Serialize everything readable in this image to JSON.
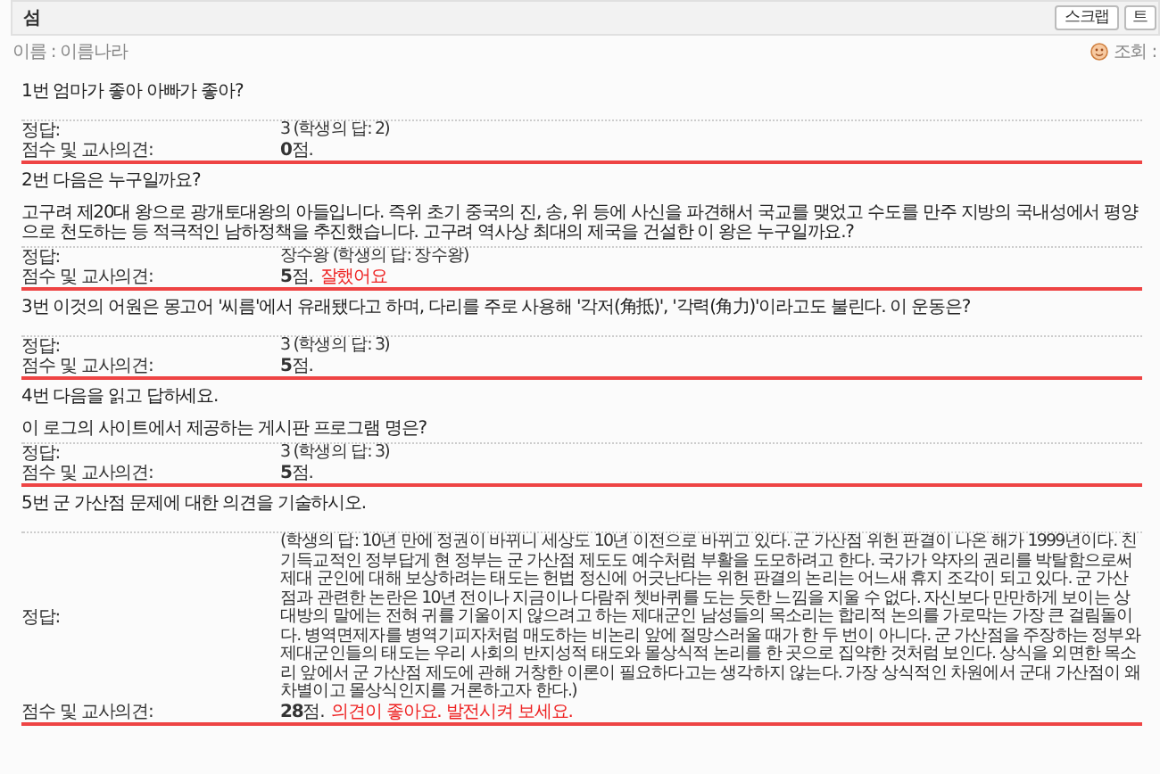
{
  "header": {
    "title": "섬",
    "buttons": [
      "스크랩",
      "트"
    ]
  },
  "meta": {
    "name": "이름 : 이름나라",
    "views": "조회 :"
  },
  "questions": [
    {
      "title": "1번 엄마가 좋아 아빠가 좋아?",
      "answer_label": "정답:",
      "answer": "3 (학생의 답: 2)",
      "score_label": "점수 및 교사의견:",
      "score": "**0**점."
    },
    {
      "title": "2번 다음은 누구일까요?",
      "body": "고구려 제20대 왕으로 광개토대왕의 아들입니다. 즉위 초기 중국의 진, 송, 위 등에 사신을 파견해서 국교를 맺었고 수도를 만주 지방의 국내성에서 평양으로 천도하는 등 적극적인 남하정책을 추진했습니다. 고구려 역사상 최대의 제국을 건설한 이 왕은 누구일까요.?",
      "answer_label": "정답:",
      "answer": "장수왕 (학생의 답: 장수왕)",
      "score_label": "점수 및 교사의견:",
      "score": "**5**점.",
      "comment": "잘했어요"
    },
    {
      "title": "3번 이것의 어원은 몽고어 '씨름'에서 유래됐다고 하며, 다리를 주로 사용해 '각저(角抵)', '각력(角力)'이라고도 불린다. 이 운동은?",
      "answer_label": "정답:",
      "answer": "3 (학생의 답: 3)",
      "score_label": "점수 및 교사의견:",
      "score": "**5**점."
    },
    {
      "title": "4번 다음을 읽고 답하세요.",
      "body": "이 로그의 사이트에서 제공하는 게시판 프로그램 명은?",
      "answer_label": "정답:",
      "answer": "3 (학생의 답: 3)",
      "score_label": "점수 및 교사의견:",
      "score": "**5**점."
    },
    {
      "title": "5번 군 가산점 문제에 대한 의견을 기술하시오.",
      "answer_label": "정답:",
      "answer": "(학생의 답: 10년 만에 정권이 바뀌니 세상도 10년 이전으로 바뀌고 있다. 군 가산점 위헌 판결이 나온 해가 1999년이다. 친기득교적인 정부답게 현 정부는 군 가산점 제도도 예수처럼 부활을 도모하려고 한다. 국가가 약자의 권리를 박탈함으로써 제대 군인에 대해 보상하려는 태도는 헌법 정신에 어긋난다는 위헌 판결의 논리는 어느새 휴지 조각이 되고 있다. 군 가산점과 관련한 논란은 10년 전이나 지금이나 다람쥐 쳇바퀴를 도는 듯한 느낌을 지울 수 없다. 자신보다 만만하게 보이는 상대방의 말에는 전혀 귀를 기울이지 않으려고 하는 제대군인 남성들의 목소리는 합리적 논의를 가로막는 가장 큰 걸림돌이다. 병역면제자를 병역기피자처럼 매도하는 비논리 앞에 절망스러울 때가 한 두 번이 아니다. 군 가산점을 주장하는 정부와 제대군인들의 태도는 우리 사회의 반지성적 태도와 몰상식적 논리를 한 곳으로 집약한 것처럼 보인다. 상식을 외면한 목소리 앞에서 군 가산점 제도에 관해 거창한 이론이 필요하다고는 생각하지 않는다. 가장 상식적인 차원에서 군대 가산점이 왜 차별이고 몰상식인지를 거론하고자 한다.)",
      "score_label": "점수 및 교사의견:",
      "score": "**28**점.",
      "comment": "의견이 좋아요. 발전시켜 보세요."
    }
  ]
}
